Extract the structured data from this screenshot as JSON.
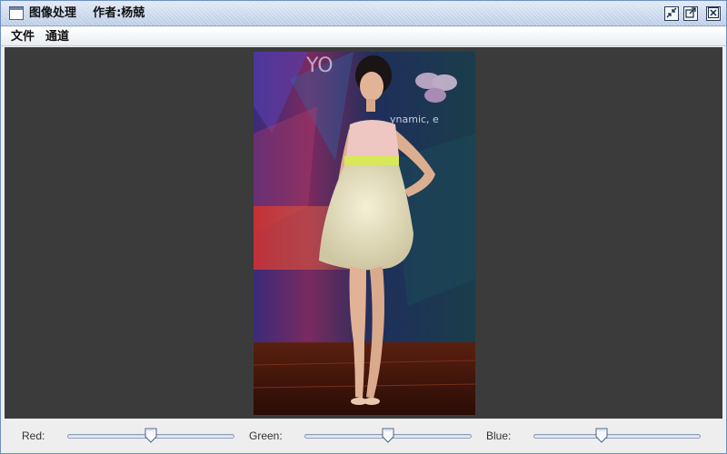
{
  "window": {
    "title": "图像处理    作者:杨兢",
    "buttons": {
      "minimize_icon": "minimize-icon",
      "maximize_icon": "maximize-icon",
      "close_icon": "close-icon"
    }
  },
  "menu": {
    "items": [
      {
        "label": "文件"
      },
      {
        "label": "通道"
      }
    ]
  },
  "sliders": {
    "red": {
      "label": "Red:",
      "value": 0.5
    },
    "green": {
      "label": "Green:",
      "value": 0.5
    },
    "blue": {
      "label": "Blue:",
      "value": 0.4
    }
  },
  "colors": {
    "titlebar": "#c8d7ec",
    "canvas_background": "#3b3b3b",
    "panel_background": "#eeeeee",
    "slider_track": "#c9d3e2"
  }
}
